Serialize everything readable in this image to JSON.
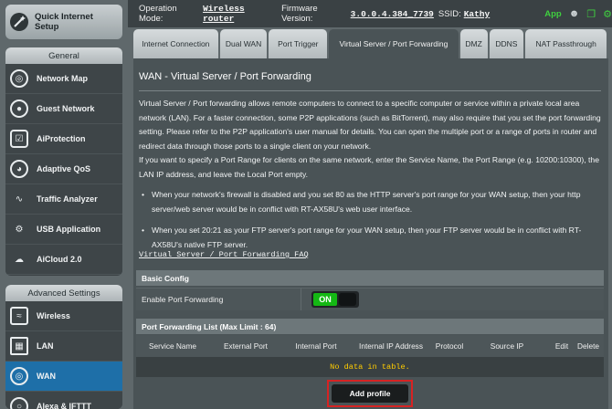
{
  "sidebar": {
    "quick_internet_setup": "Quick Internet Setup",
    "general_title": "General",
    "general_items": [
      {
        "label": "Network Map",
        "icon": "globe-network-icon"
      },
      {
        "label": "Guest Network",
        "icon": "guest-network-icon"
      },
      {
        "label": "AiProtection",
        "icon": "shield-lock-icon"
      },
      {
        "label": "Adaptive QoS",
        "icon": "speedometer-icon"
      },
      {
        "label": "Traffic Analyzer",
        "icon": "traffic-wave-icon"
      },
      {
        "label": "USB Application",
        "icon": "usb-puzzle-icon"
      },
      {
        "label": "AiCloud 2.0",
        "icon": "cloud-icon"
      }
    ],
    "advanced_title": "Advanced Settings",
    "advanced_items": [
      {
        "label": "Wireless",
        "icon": "wireless-icon"
      },
      {
        "label": "LAN",
        "icon": "lan-monitor-icon"
      },
      {
        "label": "WAN",
        "icon": "wan-globe-icon",
        "active": true
      },
      {
        "label": "Alexa & IFTTT",
        "icon": "alexa-icon"
      }
    ]
  },
  "topbar": {
    "operation_mode_label": "Operation Mode:",
    "operation_mode_value": "Wireless router",
    "firmware_label": "Firmware Version:",
    "firmware_value": "3.0.0.4.384_7739",
    "ssid_label": "SSID:",
    "ssid_value": "Kathy",
    "app_label": "App"
  },
  "tabs": [
    {
      "label": "Internet Connection"
    },
    {
      "label": "Dual WAN"
    },
    {
      "label": "Port Trigger"
    },
    {
      "label": "Virtual Server / Port Forwarding",
      "active": true
    },
    {
      "label": "DMZ"
    },
    {
      "label": "DDNS"
    },
    {
      "label": "NAT Passthrough"
    }
  ],
  "main": {
    "title": "WAN - Virtual Server / Port Forwarding",
    "description_1": "Virtual Server / Port forwarding allows remote computers to connect to a specific computer or service within a private local area network (LAN). For a faster connection, some P2P applications (such as BitTorrent), may also require that you set the port forwarding setting. Please refer to the P2P application's user manual for details. You can open the multiple port or a range of ports in router and redirect data through those ports to a single client on your network.",
    "description_2": "If you want to specify a Port Range for clients on the same network, enter the Service Name, the Port Range (e.g. 10200:10300), the LAN IP address, and leave the Local Port empty.",
    "bullet_1": "When your network's firewall is disabled and you set 80 as the HTTP server's port range for your WAN setup, then your http server/web server would be in conflict with RT-AX58U's web user interface.",
    "bullet_2": "When you set 20:21 as your FTP server's port range for your WAN setup, then your FTP server would be in conflict with RT-AX58U's native FTP server.",
    "faq_link": "Virtual Server / Port Forwarding FAQ",
    "basic_config_title": "Basic Config",
    "enable_label": "Enable Port Forwarding",
    "toggle_on": "ON",
    "list_title": "Port Forwarding List (Max Limit : 64)",
    "columns": [
      "Service Name",
      "External Port",
      "Internal Port",
      "Internal IP Address",
      "Protocol",
      "Source IP",
      "Edit",
      "Delete"
    ],
    "no_data": "No data in table.",
    "add_profile": "Add profile"
  },
  "colors": {
    "accent_active": "#1e6fa8",
    "toggle_on": "#14b814",
    "no_data_text": "#ffcc00",
    "highlight_border": "#d72323"
  }
}
